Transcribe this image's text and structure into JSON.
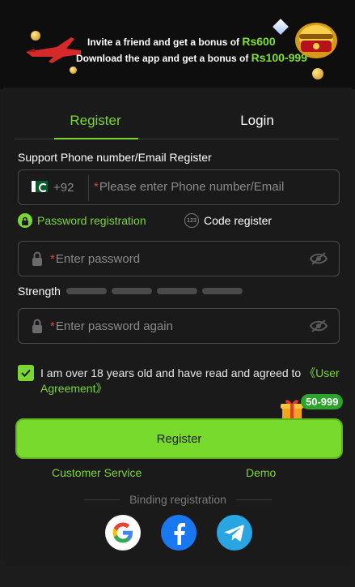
{
  "banner": {
    "line1_text": "Invite a friend and get a bonus of",
    "line1_amount": "Rs600",
    "line2_text": "Download the app and get a bonus of",
    "line2_amount": "Rs100-999"
  },
  "tabs": {
    "register": "Register",
    "login": "Login"
  },
  "form": {
    "section_title": "Support Phone number/Email Register",
    "phone_prefix": "+92",
    "phone_placeholder": "Please enter Phone number/Email",
    "required_mark": "*",
    "mode_password": "Password registration",
    "mode_code": "Code register",
    "code_icon_text": "123",
    "password_placeholder": "Enter password",
    "password_again_placeholder": "Enter password again",
    "strength_label": "Strength",
    "agree_text": "I am over 18 years old and have read and agreed to",
    "agree_link": "《User Agreement》",
    "bonus_badge": "50-999",
    "register_button": "Register",
    "customer_service": "Customer Service",
    "demo": "Demo",
    "binding_label": "Binding registration"
  },
  "colors": {
    "accent": "#7bd635",
    "button": "#78da2c",
    "background": "#1a1a1a",
    "required": "#e2463b"
  },
  "icons": [
    "plane-icon",
    "coin-icon",
    "gem-icon",
    "treasure-chest-icon",
    "pakistan-flag-icon",
    "lock-icon",
    "number-123-icon",
    "eye-off-icon",
    "checkmark-icon",
    "gift-icon",
    "google-icon",
    "facebook-icon",
    "telegram-icon"
  ]
}
